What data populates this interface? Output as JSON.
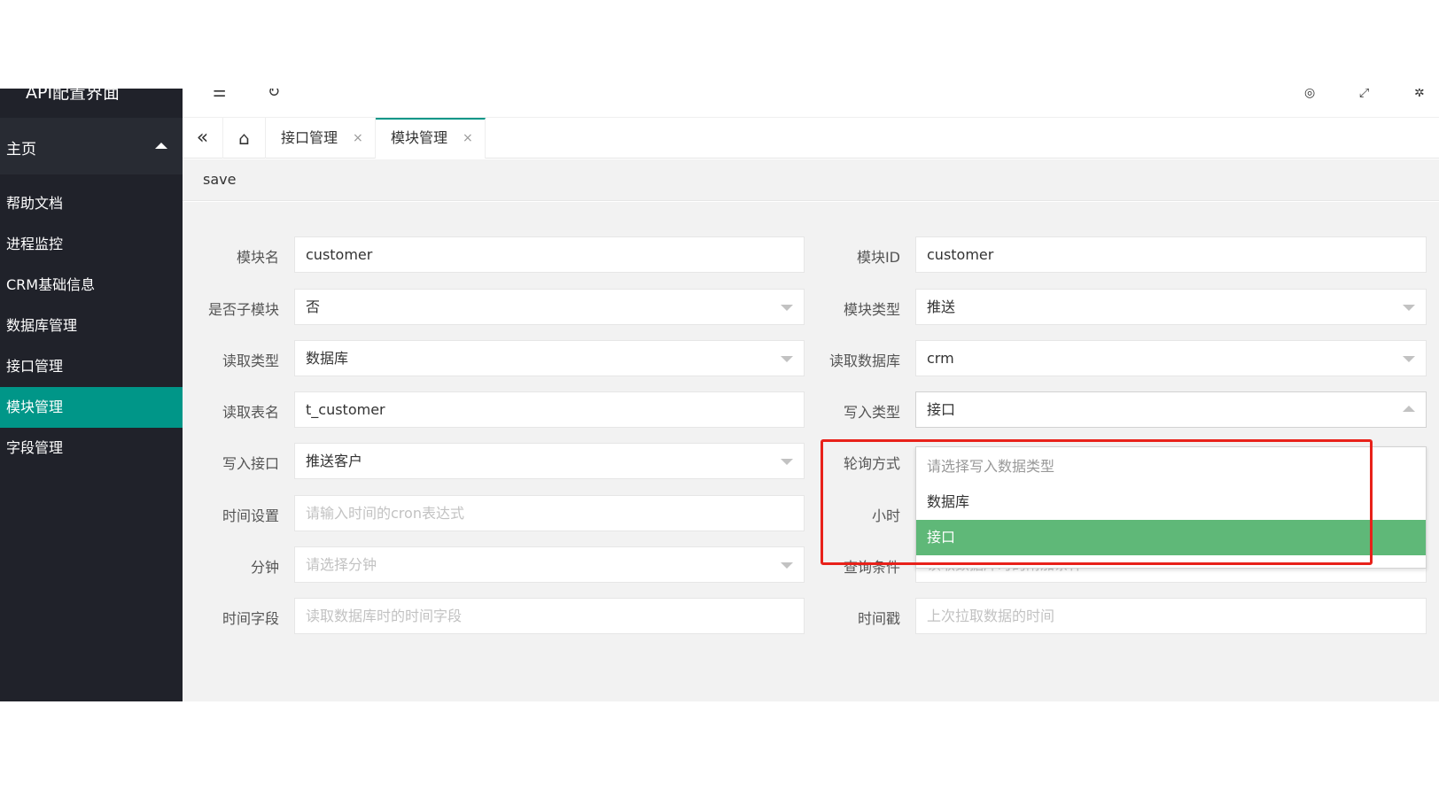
{
  "app_title": "API配置界面",
  "header": {
    "icon_menu": "menu-fold-icon",
    "icon_refresh": "refresh-icon"
  },
  "sidebar": {
    "group_label": "主页",
    "items": [
      {
        "label": "帮助文档"
      },
      {
        "label": "进程监控"
      },
      {
        "label": "CRM基础信息"
      },
      {
        "label": "数据库管理"
      },
      {
        "label": "接口管理"
      },
      {
        "label": "模块管理",
        "active": true
      },
      {
        "label": "字段管理"
      }
    ]
  },
  "tabs": [
    {
      "label": "接口管理",
      "close": "×"
    },
    {
      "label": "模块管理",
      "close": "×",
      "active": true
    }
  ],
  "toolbar": {
    "save_label": "save"
  },
  "form": {
    "module_name": {
      "label": "模块名",
      "value": "customer"
    },
    "module_id": {
      "label": "模块ID",
      "value": "customer"
    },
    "is_submodule": {
      "label": "是否子模块",
      "value": "否"
    },
    "module_type": {
      "label": "模块类型",
      "value": "推送"
    },
    "read_type": {
      "label": "读取类型",
      "value": "数据库"
    },
    "read_db": {
      "label": "读取数据库",
      "value": "crm"
    },
    "read_table": {
      "label": "读取表名",
      "value": "t_customer"
    },
    "write_type": {
      "label": "写入类型",
      "value": "接口"
    },
    "write_api": {
      "label": "写入接口",
      "value": "推送客户"
    },
    "poll_mode": {
      "label": "轮询方式"
    },
    "time_setting": {
      "label": "时间设置",
      "placeholder": "请输入时间的cron表达式"
    },
    "hour": {
      "label": "小时"
    },
    "minute": {
      "label": "分钟",
      "placeholder": "请选择分钟"
    },
    "query_condition": {
      "label": "查询条件",
      "placeholder": "读取数据库时的附加条件"
    },
    "time_field": {
      "label": "时间字段",
      "placeholder": "读取数据库时的时间字段"
    },
    "timestamp": {
      "label": "时间戳",
      "placeholder": "上次拉取数据的时间"
    }
  },
  "dropdown": {
    "options": [
      {
        "label": "请选择写入数据类型",
        "placeholder": true
      },
      {
        "label": "数据库"
      },
      {
        "label": "接口",
        "selected": true
      }
    ]
  },
  "colors": {
    "sidebar_bg": "#20222a",
    "active_teal": "#009688",
    "selected_green": "#5fb878",
    "highlight_red": "#e8211a"
  }
}
